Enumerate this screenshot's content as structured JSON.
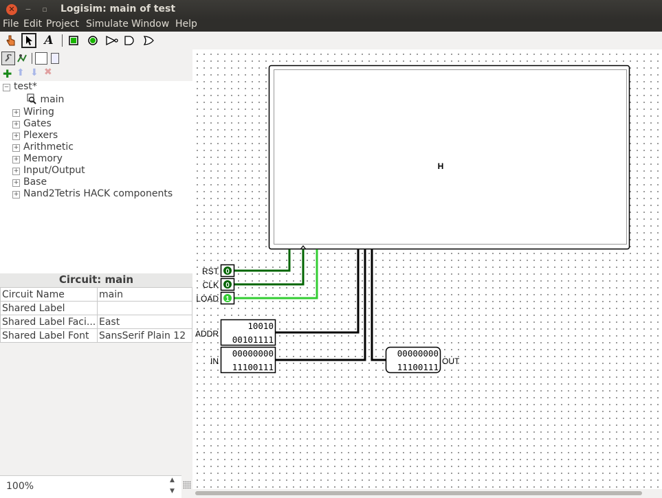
{
  "window": {
    "title": "Logisim: main of test"
  },
  "menu": [
    "File",
    "Edit",
    "Project",
    "Simulate",
    "Window",
    "Help"
  ],
  "toolbar": {
    "tools": [
      "poke-icon",
      "select-icon",
      "text-icon",
      "input-pin-icon",
      "output-pin-icon",
      "not-gate-icon",
      "and-gate-icon",
      "or-gate-icon"
    ],
    "text_tool_glyph": "A"
  },
  "explorer": {
    "project": "test*",
    "circuit": "main",
    "libraries": [
      "Wiring",
      "Gates",
      "Plexers",
      "Arithmetic",
      "Memory",
      "Input/Output",
      "Base",
      "Nand2Tetris HACK components"
    ],
    "expand_symbol": "+",
    "collapse_symbol": "−"
  },
  "attributes": {
    "title": "Circuit: main",
    "rows": [
      {
        "key": "Circuit Name",
        "value": "main"
      },
      {
        "key": "Shared Label",
        "value": ""
      },
      {
        "key": "Shared Label Faci...",
        "value": "East"
      },
      {
        "key": "Shared Label Font",
        "value": "SansSerif Plain 12"
      }
    ]
  },
  "zoom": {
    "value": "100%"
  },
  "circuit": {
    "subcircuit_label": "H",
    "pins": {
      "rst": {
        "label": "RST",
        "value": "0"
      },
      "clk": {
        "label": "CLK",
        "value": "0"
      },
      "load": {
        "label": "LOAD",
        "value": "1"
      },
      "addr": {
        "label": "ADDR",
        "line1": "10010",
        "line2": "00101111"
      },
      "in": {
        "label": "IN",
        "line1": "00000000",
        "line2": "11100111"
      },
      "out": {
        "label": "OUT",
        "line1": "00000000",
        "line2": "11100111"
      }
    }
  },
  "colors": {
    "wire_dark_green": "#006400",
    "wire_bright_green": "#32cd32",
    "bus": "#000000",
    "titlebar": "#3c3b37"
  }
}
